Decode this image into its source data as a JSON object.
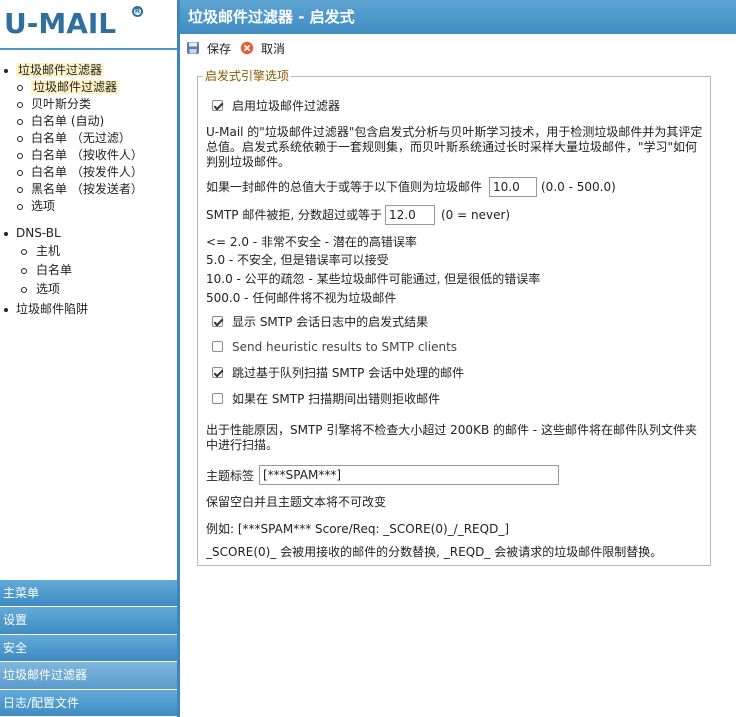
{
  "logo": {
    "text": "U-MAIL",
    "reg": "R"
  },
  "tree": {
    "items": [
      {
        "label": "垃圾邮件过滤器",
        "level": 1
      },
      {
        "label": "垃圾邮件过滤器",
        "level": 2,
        "selected": true
      },
      {
        "label": "贝叶斯分类",
        "level": 2
      },
      {
        "label": "白名单 (自动)",
        "level": 2
      },
      {
        "label": "白名单 （无过滤）",
        "level": 2
      },
      {
        "label": "白名单 （按收件人）",
        "level": 2
      },
      {
        "label": "白名单 （按发件人）",
        "level": 2
      },
      {
        "label": "黑名单 （按发送者）",
        "level": 2
      },
      {
        "label": "选项",
        "level": 2
      },
      {
        "label": "DNS-BL",
        "level": 1
      },
      {
        "label": "主机",
        "level": 3
      },
      {
        "label": "白名单",
        "level": 3
      },
      {
        "label": "选项",
        "level": 3
      },
      {
        "label": "垃圾邮件陷阱",
        "level": 1
      }
    ]
  },
  "bottom_nav": [
    {
      "label": "主菜单",
      "active": false
    },
    {
      "label": "设置",
      "active": false
    },
    {
      "label": "安全",
      "active": false
    },
    {
      "label": "垃圾邮件过滤器",
      "active": true
    },
    {
      "label": "日志/配置文件",
      "active": false
    }
  ],
  "header": {
    "title": "垃圾邮件过滤器 - 启发式"
  },
  "toolbar": {
    "save_label": "保存",
    "cancel_label": "取消"
  },
  "panel": {
    "legend": "启发式引擎选项",
    "enable_label": "启用垃圾邮件过滤器",
    "enable_checked": true,
    "description": "U-Mail 的\"垃圾邮件过滤器\"包含启发式分析与贝叶斯学习技术，用于检测垃圾邮件并为其评定总值。启发式系统依赖于一套规则集，而贝叶斯系统通过长时采样大量垃圾邮件，\"学习\"如何判别垃圾邮件。",
    "threshold_label": "如果一封邮件的总值大于或等于以下值则为垃圾邮件",
    "threshold_value": "10.0",
    "threshold_range": "(0.0 - 500.0)",
    "smtp_reject_label": "SMTP 邮件被拒, 分数超过或等于",
    "smtp_reject_value": "12.0",
    "smtp_reject_note": "(0 = never)",
    "scale": [
      "<= 2.0 - 非常不安全 - 潜在的高错误率",
      "5.0 - 不安全, 但是错误率可以接受",
      "10.0 - 公平的疏忽 - 某些垃圾邮件可能通过, 但是很低的错误率",
      "500.0 - 任何邮件将不视为垃圾邮件"
    ],
    "options": [
      {
        "label": "显示 SMTP 会话日志中的启发式结果",
        "checked": true
      },
      {
        "label": "Send heuristic results to SMTP clients",
        "checked": false
      },
      {
        "label": "跳过基于队列扫描 SMTP 会话中处理的邮件",
        "checked": true
      },
      {
        "label": "如果在 SMTP 扫描期间出错则拒收邮件",
        "checked": false
      }
    ],
    "perf_note": "出于性能原因，SMTP 引擎将不检查大小超过 200KB 的邮件 - 这些邮件将在邮件队列文件夹中进行扫描。",
    "subject_tag_label": "主题标签",
    "subject_tag_value": "[***SPAM***]",
    "blank_note": "保留空白并且主题文本将不可改变",
    "example": "例如: [***SPAM*** Score/Req: _SCORE(0)_/_REQD_]",
    "score_note": "_SCORE(0)_ 会被用接收的邮件的分数替换, _REQD_ 会被请求的垃圾邮件限制替换。"
  }
}
